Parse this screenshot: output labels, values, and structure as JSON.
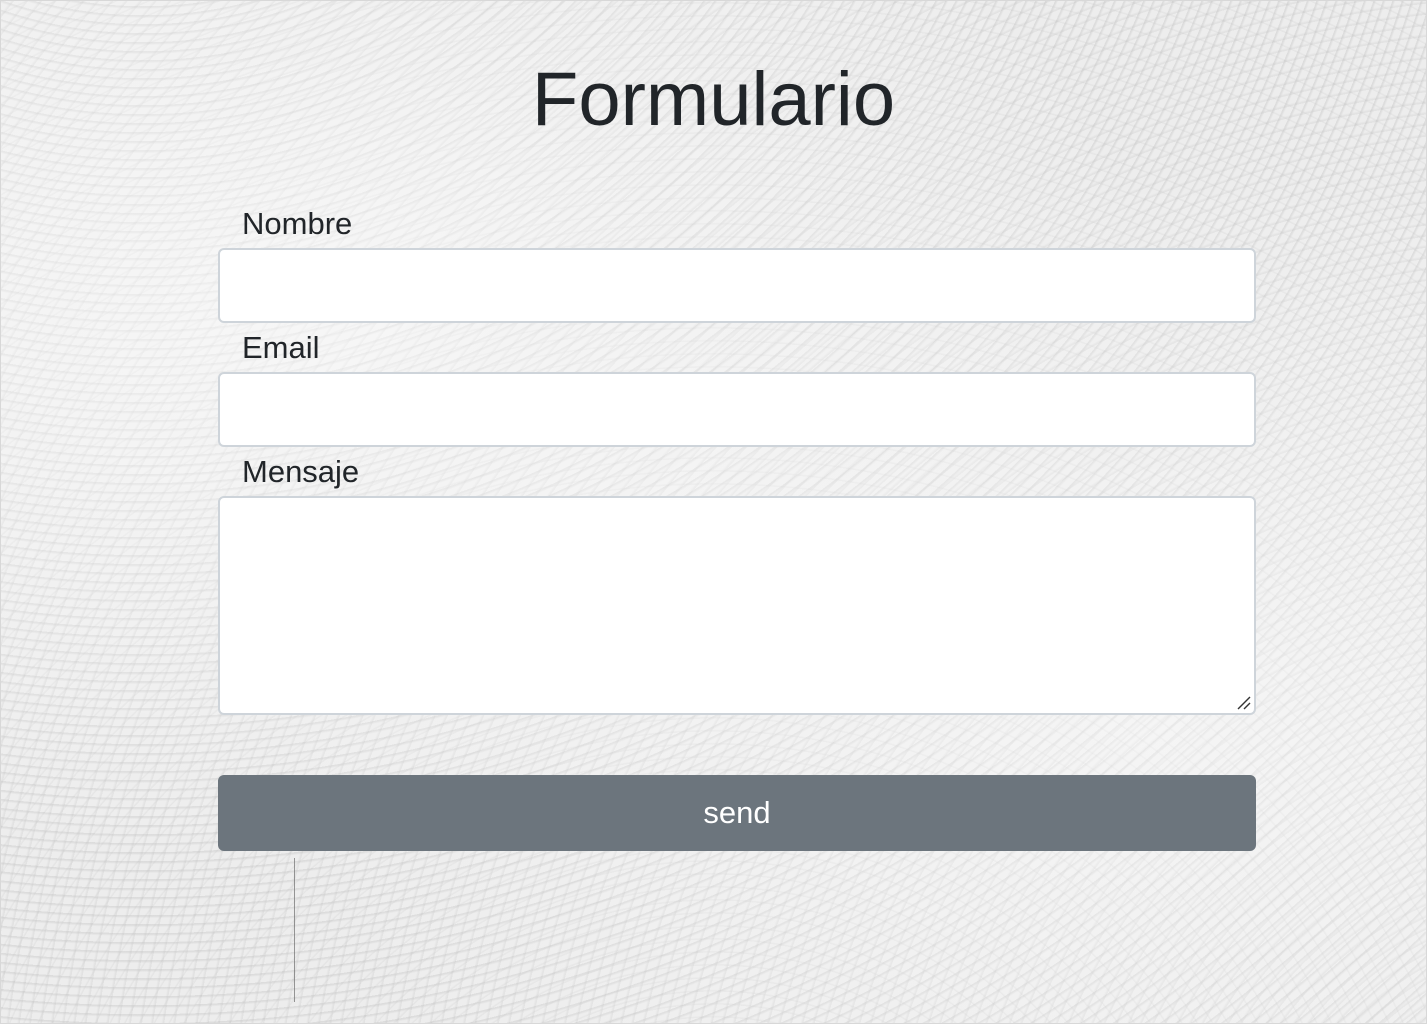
{
  "page": {
    "title": "Formulario"
  },
  "form": {
    "fields": [
      {
        "label": "Nombre",
        "value": "",
        "placeholder": ""
      },
      {
        "label": "Email",
        "value": "",
        "placeholder": ""
      },
      {
        "label": "Mensaje",
        "value": "",
        "placeholder": ""
      }
    ],
    "submit_label": "send"
  },
  "colors": {
    "text": "#212529",
    "field_border": "#ced4da",
    "button": "#6c757d",
    "button_text": "#ffffff"
  }
}
